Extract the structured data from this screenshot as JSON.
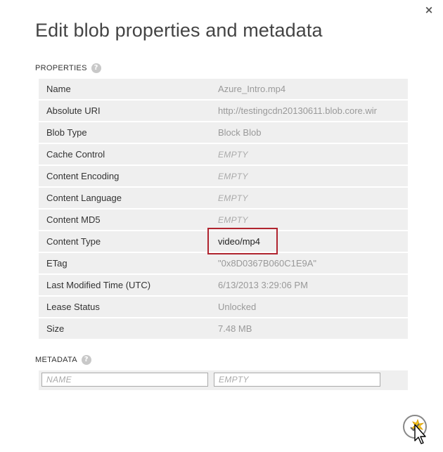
{
  "dialog": {
    "title": "Edit blob properties and metadata",
    "close_glyph": "×"
  },
  "properties": {
    "label": "PROPERTIES",
    "help_glyph": "?",
    "rows": [
      {
        "name": "Name",
        "value": "Azure_Intro.mp4",
        "empty": false
      },
      {
        "name": "Absolute URI",
        "value": "http://testingcdn20130611.blob.core.wir",
        "empty": false
      },
      {
        "name": "Blob Type",
        "value": "Block Blob",
        "empty": false
      },
      {
        "name": "Cache Control",
        "value": "EMPTY",
        "empty": true
      },
      {
        "name": "Content Encoding",
        "value": "EMPTY",
        "empty": true
      },
      {
        "name": "Content Language",
        "value": "EMPTY",
        "empty": true
      },
      {
        "name": "Content MD5",
        "value": "EMPTY",
        "empty": true
      },
      {
        "name": "Content Type",
        "value": "video/mp4",
        "empty": false,
        "editable": true
      },
      {
        "name": "ETag",
        "value": "\"0x8D0367B060C1E9A\"",
        "empty": false
      },
      {
        "name": "Last Modified Time (UTC)",
        "value": "6/13/2013 3:29:06 PM",
        "empty": false
      },
      {
        "name": "Lease Status",
        "value": "Unlocked",
        "empty": false
      },
      {
        "name": "Size",
        "value": "7.48 MB",
        "empty": false
      }
    ]
  },
  "metadata": {
    "label": "METADATA",
    "help_glyph": "?",
    "name_placeholder": "NAME",
    "value_placeholder": "EMPTY"
  },
  "colors": {
    "highlight_border": "#b0242f",
    "row_background": "#efefef",
    "confirm_star": "#f2c21a"
  },
  "icons": {
    "close": "close-icon",
    "help": "help-icon",
    "confirm": "confirm-checkmark-icon",
    "cursor": "mouse-pointer-icon"
  }
}
